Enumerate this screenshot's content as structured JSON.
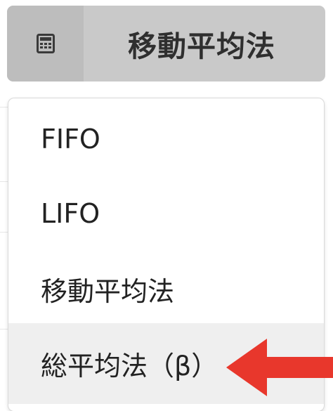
{
  "selector": {
    "icon": "calculator-icon",
    "label": "移動平均法"
  },
  "menu": {
    "items": [
      {
        "label": "FIFO"
      },
      {
        "label": "LIFO"
      },
      {
        "label": "移動平均法"
      },
      {
        "label": "総平均法（β）",
        "highlighted": true
      }
    ]
  },
  "colors": {
    "selector_bg": "#c9c9c9",
    "selector_icon_bg": "#bdbdbd",
    "highlight_bg": "#efefef",
    "arrow": "#e8372c"
  },
  "annotation": {
    "icon": "red-arrow-pointing-left"
  }
}
